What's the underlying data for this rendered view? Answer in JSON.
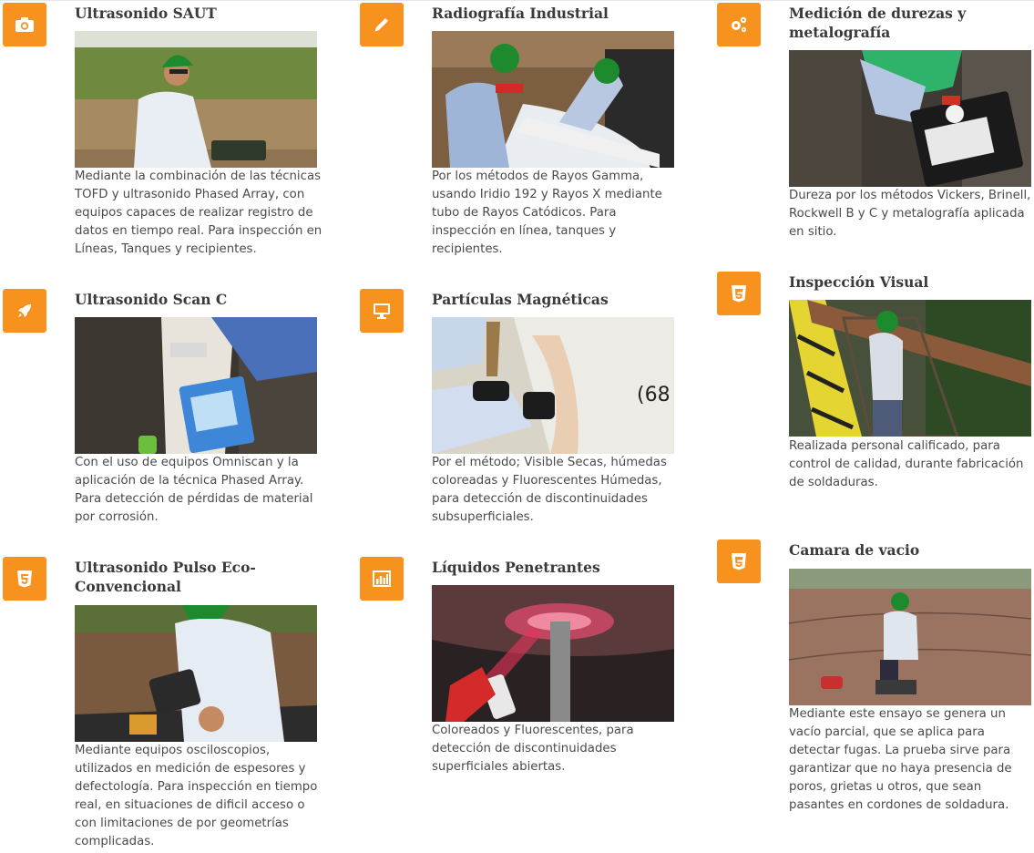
{
  "colors": {
    "accent": "#f7921e",
    "title": "#3a3a3a",
    "text": "#4a4a4a"
  },
  "services": [
    {
      "icon": "camera-icon",
      "title": "Ultrasonido SAUT",
      "description": "Mediante la combinación de las técnicas TOFD y ultrasonido Phased Array, con equipos capaces de realizar registro de datos en tiempo real. Para inspección en Líneas, Tanques y recipientes."
    },
    {
      "icon": "pencil-icon",
      "title": "Radiografía Industrial",
      "description": "Por los métodos de Rayos Gamma, usando Iridio 192 y Rayos X mediante tubo de Rayos Catódicos. Para inspección en línea, tanques y recipientes."
    },
    {
      "icon": "gears-icon",
      "title": "Medición de durezas y metalografía",
      "description": "Dureza por los métodos Vickers, Brinell, Rockwell B y C y metalografía aplicada en sitio."
    },
    {
      "icon": "rocket-icon",
      "title": "Ultrasonido Scan C",
      "description": "Con el uso de equipos Omniscan y la aplicación de la técnica Phased Array. Para detección de pérdidas de material por corrosión."
    },
    {
      "icon": "monitor-icon",
      "title": "Partículas Magnéticas",
      "description": "Por el método; Visible Secas, húmedas coloreadas y Fluorescentes Húmedas, para detección de discontinuidades subsuperficiales."
    },
    {
      "icon": "css3-icon",
      "title": "Inspección Visual",
      "description": "Realizada personal calificado, para control de calidad, durante fabricación de soldaduras."
    },
    {
      "icon": "html5-icon",
      "title": "Ultrasonido Pulso Eco-Convencional",
      "description": "Mediante equipos osciloscopios, utilizados en medición de espesores y defectología. Para inspección en tiempo real, en situaciones de dificil acceso o con limitaciones de por geometrías complicadas."
    },
    {
      "icon": "bar-chart-icon",
      "title": "Líquidos Penetrantes",
      "description": "Coloreados y Fluorescentes, para detección de discontinuidades superficiales abiertas."
    },
    {
      "icon": "css3-icon",
      "title": "Camara de vacio",
      "description": "Mediante este ensayo se genera un vacío parcial, que se aplica para detectar fugas. La prueba sirve para garantizar que no haya presencia de poros, grietas u otros, que sean pasantes en cordones de soldadura."
    }
  ]
}
